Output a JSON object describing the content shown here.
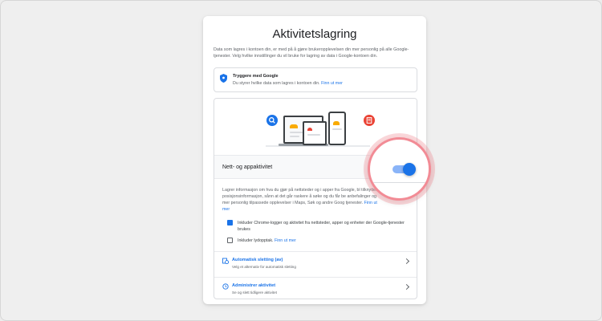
{
  "page": {
    "title": "Aktivitetslagring",
    "description": "Data som lagres i kontoen din, er med på å gjøre brukeropplevelsen din mer personlig på alle Google-tjenester. Velg hvilke innstillinger du vil bruke for lagring av data i Google-kontoen din."
  },
  "safer": {
    "icon": "shield-icon",
    "title": "Tryggere med Google",
    "text": "Du styrer hvilke data som lagres i kontoen din.",
    "link": "Finn ut mer"
  },
  "web_app": {
    "label": "Nett- og appaktivitet",
    "toggle_state": "on",
    "description": "Lagrer informasjon om hva du gjør på nettsteder og i apper fra Google, bl tilknyttet posisjonsinformasjon, sånn at det går raskere å søke og du får be anbefalinger og mer personlig tilpassede opplevelser i Maps, Søk og andre Goog tjenester.",
    "description_link": "Finn ut mer",
    "checkboxes": [
      {
        "label": "Inkluder Chrome-logger og aktivitet fra nettsteder, apper og enheter der Google-tjenester brukes",
        "checked": true
      },
      {
        "label": "Inkluder lydopptak.",
        "link": "Finn ut mer",
        "checked": false
      }
    ]
  },
  "rows": [
    {
      "icon": "auto-delete-icon",
      "title": "Automatisk sletting (av)",
      "subtitle": "Velg et alternativ for automatisk sletting"
    },
    {
      "icon": "history-icon",
      "title": "Administrer aktivitet",
      "subtitle": "Se og slett tidligere aktivitet"
    }
  ],
  "colors": {
    "accent": "#1a73e8",
    "highlight_ring": "#f28b95",
    "background": "#efefef"
  }
}
